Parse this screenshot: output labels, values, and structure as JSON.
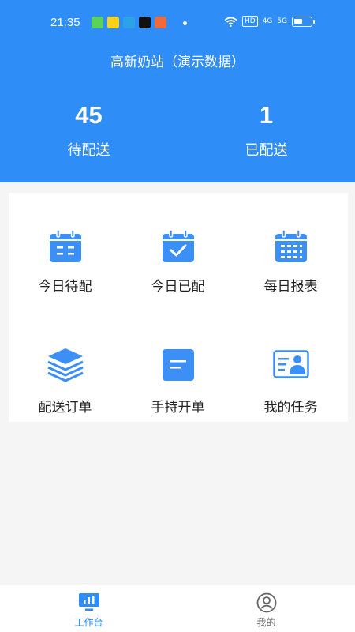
{
  "status_bar": {
    "time": "21:35",
    "hd": "HD",
    "signal_a": "4G",
    "signal_b": "5G"
  },
  "header": {
    "title": "高新奶站（演示数据）",
    "stats": [
      {
        "value": "45",
        "label": "待配送"
      },
      {
        "value": "1",
        "label": "已配送"
      }
    ]
  },
  "grid": {
    "items": [
      {
        "label": "今日待配",
        "icon": "calendar-list-icon"
      },
      {
        "label": "今日已配",
        "icon": "calendar-check-icon"
      },
      {
        "label": "每日报表",
        "icon": "calendar-grid-icon"
      },
      {
        "label": "配送订单",
        "icon": "layers-icon"
      },
      {
        "label": "手持开单",
        "icon": "document-icon"
      },
      {
        "label": "我的任务",
        "icon": "id-card-icon"
      }
    ]
  },
  "bottom_nav": {
    "tabs": [
      {
        "label": "工作台",
        "active": true
      },
      {
        "label": "我的",
        "active": false
      }
    ]
  },
  "colors": {
    "primary": "#2f8df7",
    "icon_blue": "#3b8ff5",
    "active_text": "#2f8df7",
    "inactive_text": "#666666"
  }
}
